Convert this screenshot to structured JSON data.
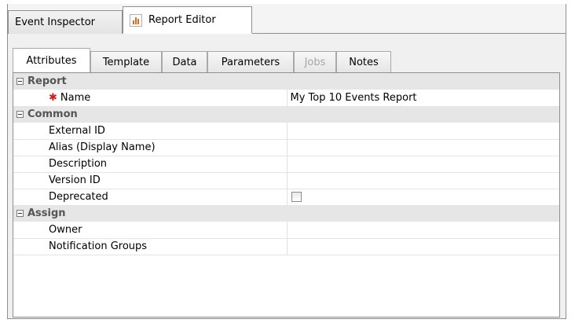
{
  "top_tabs": [
    {
      "label": "Event Inspector",
      "active": false
    },
    {
      "label": "Report Editor",
      "active": true,
      "icon": "report-chart-icon"
    }
  ],
  "sub_tabs": [
    {
      "label": "Attributes",
      "active": true
    },
    {
      "label": "Template"
    },
    {
      "label": "Data"
    },
    {
      "label": "Parameters"
    },
    {
      "label": "Jobs",
      "disabled": true
    },
    {
      "label": "Notes"
    }
  ],
  "sections": [
    {
      "title": "Report",
      "rows": [
        {
          "label": "Name",
          "required": true,
          "value": "My Top 10 Events Report"
        }
      ]
    },
    {
      "title": "Common",
      "rows": [
        {
          "label": "External ID",
          "value": ""
        },
        {
          "label": "Alias (Display Name)",
          "value": ""
        },
        {
          "label": "Description",
          "value": ""
        },
        {
          "label": "Version ID",
          "value": ""
        },
        {
          "label": "Deprecated",
          "value": "",
          "checkbox": true,
          "checked": false
        }
      ]
    },
    {
      "title": "Assign",
      "rows": [
        {
          "label": "Owner",
          "value": ""
        },
        {
          "label": "Notification Groups",
          "value": ""
        }
      ]
    }
  ],
  "colors": {
    "required": "#cc1e1e",
    "category_bg": "#e6e6e6",
    "icon_bars": "#e36b1e"
  }
}
